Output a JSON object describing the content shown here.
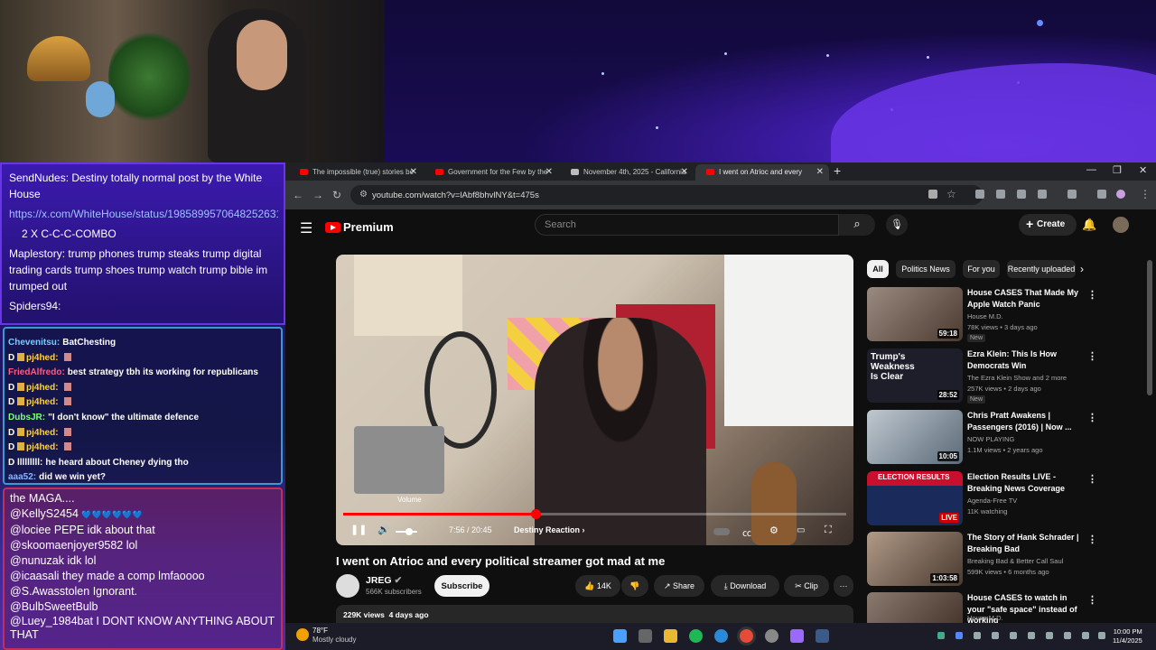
{
  "chat_top": {
    "messages": [
      {
        "user": "SendNudes:",
        "text": "Destiny totally normal post by the White House"
      },
      {
        "link": "https://x.com/WhiteHouse/status/1985899570648252631"
      },
      {
        "text": "2 X C-C-C-COMBO"
      },
      {
        "user": "Maplestory:",
        "text": "trump phones trump steaks trump digital trading cards trump shoes trump watch trump bible im trumped out"
      },
      {
        "user": "Spiders94:",
        "text": ""
      }
    ]
  },
  "chat_mid": {
    "messages": [
      {
        "user": "Chevenitsu:",
        "text": "BatChesting",
        "color": "#6fd0ff"
      },
      {
        "user": "pj4hed:",
        "text": "",
        "color": "#ffd23a"
      },
      {
        "user": "FriedAlfredo:",
        "text": "best strategy tbh its working for republicans",
        "color": "#ff5a8a"
      },
      {
        "user": "pj4hed:",
        "text": "",
        "color": "#ffd23a"
      },
      {
        "user": "pj4hed:",
        "text": "",
        "color": "#ffd23a"
      },
      {
        "user": "DubsJR:",
        "text": "\"I don't know\" the ultimate defence",
        "color": "#7cff7c"
      },
      {
        "user": "pj4hed:",
        "text": "",
        "color": "#ffd23a"
      },
      {
        "user": "pj4hed:",
        "text": "",
        "color": "#ffd23a"
      },
      {
        "user": "lllllllll:",
        "text": "he heard about Cheney dying tho",
        "color": "#ffffff"
      },
      {
        "user": "aaa52:",
        "text": "did we win yet?",
        "color": "#8ab4ff"
      }
    ]
  },
  "chat_bottom": {
    "messages": [
      {
        "user": "",
        "text": "the MAGA...."
      },
      {
        "user": "@KellyS2454",
        "text": "💙💙💙💙💙💙"
      },
      {
        "user": "@lociee",
        "text": "PEPE idk about that"
      },
      {
        "user": "@skoomaenjoyer9582",
        "text": "lol"
      },
      {
        "user": "@nunuzak",
        "text": "idk lol"
      },
      {
        "user": "@icaasali",
        "text": "they made a comp lmfaoooo"
      },
      {
        "user": "@S.Awasstolen",
        "text": "Ignorant."
      },
      {
        "user": "@BulbSweetBulb",
        "text": ""
      },
      {
        "user": "@Luey_1984bat",
        "text": "I DONT KNOW ANYTHING ABOUT THAT"
      }
    ]
  },
  "browser": {
    "tabs": [
      {
        "label": "The impossible (true) stories be"
      },
      {
        "label": "Government for the Few by the"
      },
      {
        "label": "November 4th, 2025 - California"
      },
      {
        "label": "I went on Atrioc and every"
      }
    ],
    "new_tab": "+",
    "url": "youtube.com/watch?v=lAbf8bhvlNY&t=475s"
  },
  "youtube": {
    "logo": "Premium",
    "search_placeholder": "Search",
    "create_label": "Create",
    "player": {
      "volume_tooltip": "Volume",
      "time": "7:56 / 20:45",
      "chapter": "Destiny Reaction",
      "progress": 0.382
    },
    "video": {
      "title": "I went on Atrioc and every political streamer got mad at me",
      "channel": "JREG",
      "subscribers": "566K subscribers",
      "subscribe": "Subscribe",
      "likes": "14K",
      "share": "Share",
      "download": "Download",
      "clip": "Clip",
      "views": "229K views",
      "age": "4 days ago"
    },
    "chips": [
      "All",
      "Politics News",
      "For you",
      "Recently uploaded"
    ],
    "recommendations": [
      {
        "title": "House CASES That Made My Apple Watch Panic",
        "channel": "House M.D.",
        "meta": "78K views • 3 days ago",
        "badge": "New",
        "duration": "59:18",
        "thumb": "#8a7a70"
      },
      {
        "title": "Ezra Klein: This Is How Democrats Win",
        "channel": "The Ezra Klein Show and 2 more",
        "meta": "257K views • 2 days ago",
        "badge": "New",
        "duration": "28:52",
        "thumb_text": "Trump's Weakness Is Clear",
        "thumb": "#2a2a3a"
      },
      {
        "title": "Chris Pratt Awakens | Passengers (2016) | Now ...",
        "channel": "NOW PLAYING",
        "meta": "1.1M views • 2 years ago",
        "badge": "",
        "duration": "10:05",
        "thumb": "#9aa8b8"
      },
      {
        "title": "Election Results LIVE - Breaking News Coverage",
        "channel": "Agenda-Free TV",
        "meta": "11K watching",
        "badge": "",
        "duration": "LIVE",
        "thumb_text": "ELECTION RESULTS",
        "thumb": "#c8102e"
      },
      {
        "title": "The Story of Hank Schrader | Breaking Bad",
        "channel": "Breaking Bad & Better Call Saul",
        "meta": "599K views • 6 months ago",
        "badge": "",
        "duration": "1:03:58",
        "thumb": "#8a7a6a"
      },
      {
        "title": "House CASES to watch in your \"safe space\" instead of working",
        "channel": "House M.D.",
        "meta": "",
        "badge": "",
        "duration": "",
        "thumb": "#6a5a50"
      }
    ]
  },
  "taskbar": {
    "temp": "78°F",
    "weather": "Mostly cloudy",
    "time": "10:00 PM",
    "date": "11/4/2025"
  }
}
